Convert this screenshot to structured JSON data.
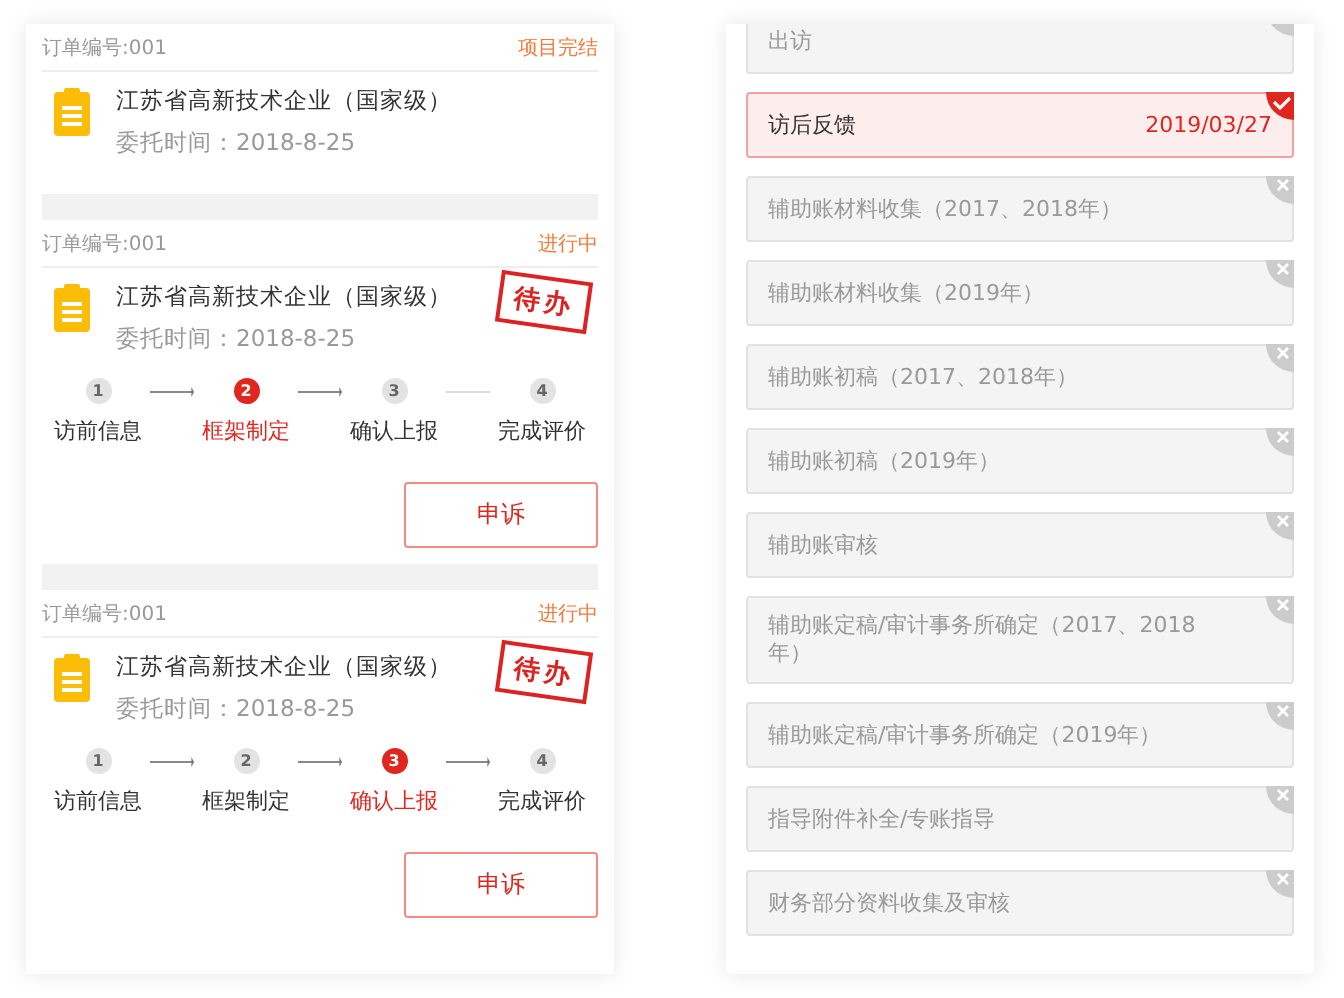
{
  "orders": [
    {
      "order_no": "订单编号:001",
      "status": "项目完结",
      "company": "江苏省高新技术企业（国家级）",
      "date": "委托时间：2018-8-25"
    },
    {
      "order_no": "订单编号:001",
      "status": "进行中",
      "company": "江苏省高新技术企业（国家级）",
      "date": "委托时间：2018-8-25",
      "stamp": "待办",
      "steps": [
        {
          "num": "1",
          "label": "访前信息",
          "selected": false
        },
        {
          "num": "2",
          "label": "框架制定",
          "selected": true
        },
        {
          "num": "3",
          "label": "确认上报",
          "selected": false
        },
        {
          "num": "4",
          "label": "完成评价",
          "selected": false
        }
      ],
      "button": "申诉"
    },
    {
      "order_no": "订单编号:001",
      "status": "进行中",
      "company": "江苏省高新技术企业（国家级）",
      "date": "委托时间：2018-8-25",
      "stamp": "待办",
      "steps": [
        {
          "num": "1",
          "label": "访前信息",
          "selected": false
        },
        {
          "num": "2",
          "label": "框架制定",
          "selected": false
        },
        {
          "num": "3",
          "label": "确认上报",
          "selected": true
        },
        {
          "num": "4",
          "label": "完成评价",
          "selected": false
        }
      ],
      "button": "申诉"
    }
  ],
  "tasks": [
    {
      "kind": "cancelled",
      "label": "出访"
    },
    {
      "kind": "done",
      "label": "访后反馈",
      "date": "2019/03/27"
    },
    {
      "kind": "cancelled",
      "label": "辅助账材料收集（2017、2018年）"
    },
    {
      "kind": "cancelled",
      "label": "辅助账材料收集（2019年）"
    },
    {
      "kind": "cancelled",
      "label": "辅助账初稿（2017、2018年）"
    },
    {
      "kind": "cancelled",
      "label": "辅助账初稿（2019年）"
    },
    {
      "kind": "cancelled",
      "label": "辅助账审核"
    },
    {
      "kind": "cancelled",
      "label": "辅助账定稿/审计事务所确定（2017、2018年）"
    },
    {
      "kind": "cancelled",
      "label": "辅助账定稿/审计事务所确定（2019年）"
    },
    {
      "kind": "cancelled",
      "label": "指导附件补全/专账指导"
    },
    {
      "kind": "cancelled",
      "label": "财务部分资料收集及审核"
    }
  ]
}
